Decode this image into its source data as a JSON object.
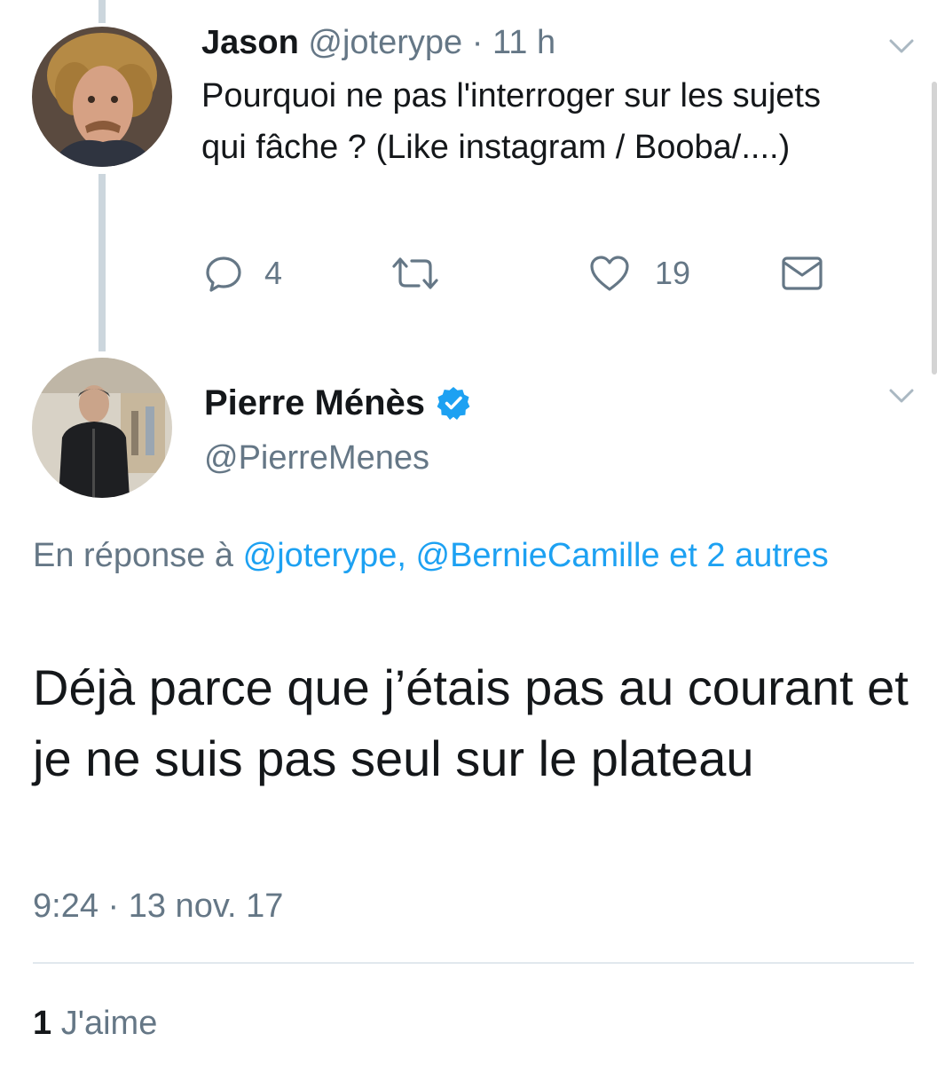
{
  "tweet1": {
    "display_name": "Jason",
    "handle": "@joterype",
    "separator": "·",
    "time": "11 h",
    "text": "Pourquoi ne pas l'interroger sur les sujets qui fâche ? (Like instagram / Booba/....)",
    "reply_count": "4",
    "like_count": "19",
    "icons": [
      "reply-icon",
      "retweet-icon",
      "heart-icon",
      "dm-icon",
      "chevron-down-icon"
    ]
  },
  "tweet2": {
    "display_name": "Pierre Ménès",
    "verified": true,
    "handle": "@PierreMenes",
    "reply_prefix": "En réponse à",
    "reply_mentions": "@joterype, @BernieCamille et 2 autres",
    "text": "Déjà parce que j’étais pas au courant et je ne suis pas seul sur le plateau",
    "timestamp": "9:24 · 13 nov. 17",
    "likes_count": "1",
    "likes_label": "J'aime"
  },
  "colors": {
    "accent": "#1da1f2",
    "muted_text": "#657786",
    "body_text": "#14171a",
    "thread_line": "#ccd6dd",
    "divider": "#e1e8ed"
  }
}
